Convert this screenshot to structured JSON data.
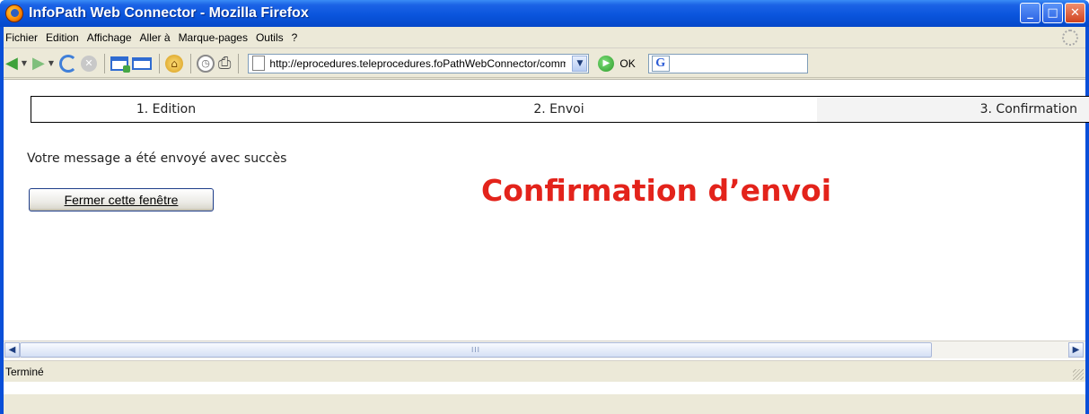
{
  "window": {
    "title": "InfoPath Web Connector - Mozilla Firefox",
    "minimize_glyph": "_",
    "maximize_glyph": "□",
    "close_glyph": "✕"
  },
  "menubar": {
    "items": [
      "Fichier",
      "Edition",
      "Affichage",
      "Aller à",
      "Marque-pages",
      "Outils",
      "?"
    ]
  },
  "navbar": {
    "url": "http://eprocedures.teleprocedures.foPathWebConnector/common",
    "go_label": "OK",
    "search_engine_glyph": "G"
  },
  "content": {
    "steps": [
      "1. Edition",
      "2. Envoi",
      "3. Confirmation"
    ],
    "message": "Votre message a été envoyé avec succès",
    "close_button_label": "Fermer cette fenêtre",
    "heading": "Confirmation d’envoi",
    "heading_color": "#e3231b"
  },
  "scrollbar": {
    "thumb_grip": "III"
  },
  "statusbar": {
    "text": "Terminé"
  }
}
